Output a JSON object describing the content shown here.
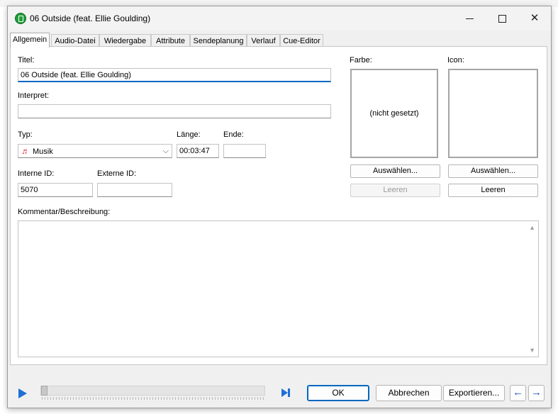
{
  "window": {
    "title": "06 Outside (feat. Ellie Goulding)",
    "close_glyph": "✕"
  },
  "tabs": [
    {
      "label": "Allgemein",
      "active": true
    },
    {
      "label": "Audio-Datei"
    },
    {
      "label": "Wiedergabe"
    },
    {
      "label": "Attribute"
    },
    {
      "label": "Sendeplanung"
    },
    {
      "label": "Verlauf"
    },
    {
      "label": "Cue-Editor"
    }
  ],
  "form": {
    "title_label": "Titel:",
    "title_value": "06 Outside (feat. Ellie Goulding)",
    "artist_label": "Interpret:",
    "artist_value": "",
    "type_label": "Typ:",
    "type_value": "Musik",
    "type_icon": "music-note-icon",
    "length_label": "Länge:",
    "length_value": "00:03:47",
    "end_label": "Ende:",
    "end_value": "",
    "internal_id_label": "Interne ID:",
    "internal_id_value": "5070",
    "external_id_label": "Externe ID:",
    "external_id_value": "",
    "comment_label": "Kommentar/Beschreibung:",
    "comment_value": ""
  },
  "color": {
    "label": "Farbe:",
    "preview_text": "(nicht gesetzt)",
    "choose_button": "Auswählen...",
    "clear_button": "Leeren",
    "clear_enabled": false
  },
  "icon": {
    "label": "Icon:",
    "choose_button": "Auswählen...",
    "clear_button": "Leeren",
    "clear_enabled": true
  },
  "footer": {
    "position_fraction": 0,
    "ok_button": "OK",
    "cancel_button": "Abbrechen",
    "export_button": "Exportieren...",
    "prev_glyph": "←",
    "next_glyph": "→",
    "accent_color": "#1f6fd6"
  }
}
